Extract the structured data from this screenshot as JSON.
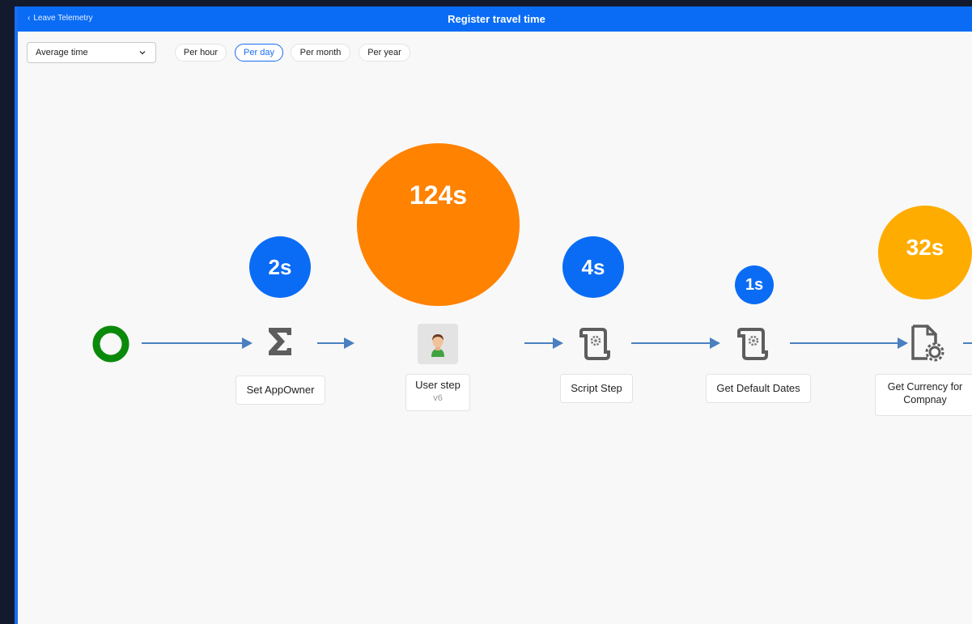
{
  "header": {
    "back_label": "Leave Telemetry",
    "title": "Register travel time"
  },
  "toolbar": {
    "metric_select": "Average time",
    "periods": [
      "Per hour",
      "Per day",
      "Per month",
      "Per year"
    ],
    "active_period": "Per day"
  },
  "colors": {
    "header_blue": "#0a6cf5",
    "bubble_blue": "#0a6cf5",
    "bubble_orange": "#ff8200",
    "bubble_amber": "#ffac00",
    "start_green": "#0a8a0a",
    "arrow": "#4a7fc0"
  },
  "flow": {
    "nodes": [
      {
        "label": "Set AppOwner",
        "time": "2s",
        "icon": "sigma-icon"
      },
      {
        "label": "User step",
        "sub": "v6",
        "time": "124s",
        "icon": "user-avatar-icon"
      },
      {
        "label": "Script Step",
        "time": "4s",
        "icon": "script-scroll-icon"
      },
      {
        "label": "Get Default Dates",
        "time": "1s",
        "icon": "script-scroll-icon"
      },
      {
        "label": "Get Currency for Compnay",
        "time": "32s",
        "icon": "document-gear-icon"
      }
    ]
  }
}
